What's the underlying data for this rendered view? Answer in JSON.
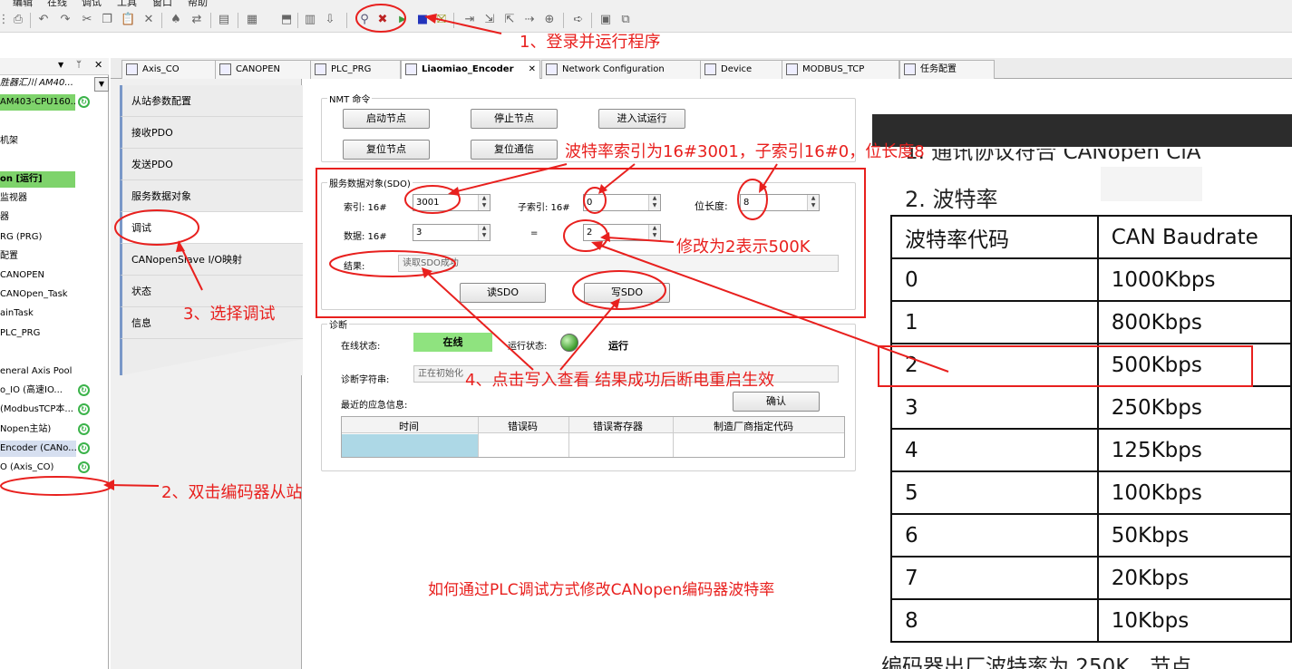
{
  "menubar": {
    "items": [
      "编辑",
      "在线",
      "调试",
      "工具",
      "窗口",
      "帮助"
    ]
  },
  "tree": {
    "items": [
      {
        "label": "胜器汇川 AM40...",
        "status": ""
      },
      {
        "label": "AM403-CPU160...",
        "status": "ok",
        "highlight": true
      },
      {
        "label": "",
        "status": ""
      },
      {
        "label": "机架",
        "status": ""
      },
      {
        "label": "",
        "status": ""
      },
      {
        "label": "on [运行]",
        "status": "",
        "highlight": true
      },
      {
        "label": "监视器",
        "status": ""
      },
      {
        "label": "器",
        "status": ""
      },
      {
        "label": "RG (PRG)",
        "status": ""
      },
      {
        "label": "配置",
        "status": ""
      },
      {
        "label": "CANOPEN",
        "status": ""
      },
      {
        "label": "CANOpen_Task",
        "status": ""
      },
      {
        "label": "ainTask",
        "status": ""
      },
      {
        "label": "PLC_PRG",
        "status": ""
      },
      {
        "label": "",
        "status": ""
      },
      {
        "label": "eneral Axis Pool",
        "status": ""
      },
      {
        "label": "o_IO (高速IO...",
        "status": "ok"
      },
      {
        "label": "(ModbusTCP本...",
        "status": "ok"
      },
      {
        "label": "Nopen主站)",
        "status": "ok"
      },
      {
        "label": "Encoder (CANo...",
        "status": "ok",
        "selected": true
      },
      {
        "label": "O (Axis_CO)",
        "status": "ok"
      }
    ]
  },
  "tabs": [
    {
      "label": "Axis_CO"
    },
    {
      "label": "CANOPEN"
    },
    {
      "label": "PLC_PRG"
    },
    {
      "label": "Liaomiao_Encoder",
      "active": true
    },
    {
      "label": "Network Configuration"
    },
    {
      "label": "Device"
    },
    {
      "label": "MODBUS_TCP"
    },
    {
      "label": "任务配置"
    }
  ],
  "config_pane": {
    "items": [
      "从站参数配置",
      "接收PDO",
      "发送PDO",
      "服务数据对象",
      "调试",
      "CANopenSlave I/O映射",
      "状态",
      "信息"
    ],
    "selected": "调试"
  },
  "nmt": {
    "legend": "NMT 命令",
    "buttons": {
      "start": "启动节点",
      "stop": "停止节点",
      "preop": "进入试运行",
      "reset_node": "复位节点",
      "reset_comm": "复位通信"
    }
  },
  "sdo": {
    "legend": "服务数据对象(SDO)",
    "index_label": "索引:  16#",
    "index_value": "3001",
    "subindex_label": "子索引: 16#",
    "subindex_value": "0",
    "bitlen_label": "位长度:",
    "bitlen_value": "8",
    "data_label": "数据:  16#",
    "data_value": "3",
    "equals": "=",
    "data_value2": "2",
    "result_label": "结果:",
    "result_value": "读取SDO成功",
    "read_button": "读SDO",
    "write_button": "写SDO"
  },
  "diag": {
    "legend": "诊断",
    "online_label": "在线状态:",
    "online_value": "在线",
    "run_label": "运行状态:",
    "run_value": "运行",
    "diag_string_label": "诊断字符串:",
    "diag_string_value": "正在初始化",
    "emergency_label": "最近的应急信息:",
    "confirm_button": "确认",
    "table_headers": [
      "时间",
      "错误码",
      "错误寄存器",
      "制造厂商指定代码"
    ]
  },
  "doc_image": {
    "section": "2.   波特率",
    "top_cut": "1.   通讯协议符合 CANopen CiA",
    "headers": [
      "波特率代码",
      "CAN Baudrate"
    ],
    "rows": [
      [
        "0",
        "1000Kbps"
      ],
      [
        "1",
        "800Kbps"
      ],
      [
        "2",
        "500Kbps"
      ],
      [
        "3",
        "250Kbps"
      ],
      [
        "4",
        "125Kbps"
      ],
      [
        "5",
        "100Kbps"
      ],
      [
        "6",
        "50Kbps"
      ],
      [
        "7",
        "20Kbps"
      ],
      [
        "8",
        "10Kbps"
      ]
    ],
    "bottom_cut": "编码器出厂波特率为 250K，节点"
  },
  "annotations": {
    "step1": "1、登录并运行程序",
    "step2": "2、双击编码器从站",
    "step3": "3、选择调试",
    "step4": "4、点击写入查看 结果成功后断电重启生效",
    "sdo_note": "波特率索引为16#3001，子索引16#0，位长度8",
    "edit_note": "修改为2表示500K",
    "caption": "如何通过PLC调试方式修改CANopen编码器波特率"
  },
  "colors": {
    "annotation": "#e8201e",
    "online_green": "#8fe37f",
    "highlight_green": "#7ed36b",
    "selection_blue": "#add8e6"
  }
}
